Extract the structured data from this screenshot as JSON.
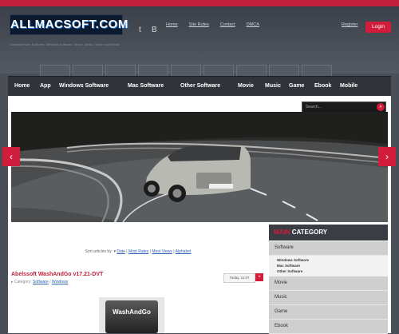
{
  "header": {
    "logo": "ALLMACSOFT.COM",
    "tagline": "Download Mac Software, Windows Software, Movie, Music, Game and Ebook",
    "social": [
      "t",
      "B"
    ],
    "links": [
      "Home",
      "Site Rules",
      "Contact",
      "DMCA"
    ],
    "register": "Register",
    "login": "Login"
  },
  "nav": {
    "items": [
      "Home",
      "App",
      "Windows Software",
      "Mac Software",
      "Other Software",
      "Movie",
      "Music",
      "Game",
      "Ebook",
      "Mobile"
    ]
  },
  "search": {
    "placeholder": "Search..."
  },
  "slider": {
    "prev": "‹",
    "next": "›"
  },
  "sort": {
    "label": "Sort articles by:",
    "options": [
      "Date",
      "Most Rates",
      "Most Views",
      "Alphabet"
    ]
  },
  "post": {
    "title": "Abelssoft WashAndGo v17.21-DVT",
    "category_label": "Category:",
    "categories": [
      "Software",
      "Windows"
    ],
    "date": "Today, 11:07",
    "app_name": "WashAndGo"
  },
  "sidebar": {
    "title_highlight": "MAIN",
    "title_rest": "CATEGORY",
    "items": [
      "Software",
      "Movie",
      "Music",
      "Game",
      "Ebook"
    ],
    "sub_items": [
      "Windows Software",
      "Mac Software",
      "Other Software"
    ]
  },
  "colors": {
    "accent": "#d21c3c",
    "nav": "#30343a",
    "header": "#4a4f57"
  }
}
